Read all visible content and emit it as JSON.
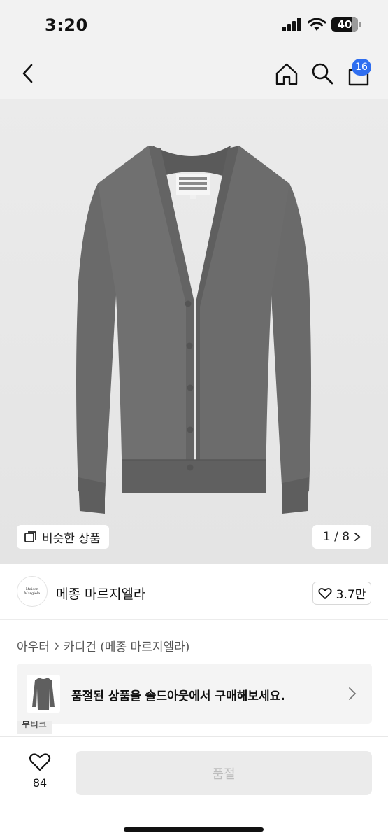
{
  "status_bar": {
    "time": "3:20",
    "battery": "40"
  },
  "nav": {
    "cart_count": "16"
  },
  "gallery": {
    "similar_label": "비슷한 상품",
    "pager": "1 / 8"
  },
  "brand": {
    "name": "메종 마르지엘라",
    "likes": "3.7만",
    "logo_text": "Maison Margiela"
  },
  "breadcrumb": {
    "category": "아우터",
    "subcategory": "카디건 (메종 마르지엘라)"
  },
  "soldout_banner": {
    "text": "품절된 상품을 솔드아웃에서 구매해보세요."
  },
  "boutique_tag": "부티크",
  "bottom_bar": {
    "wish_count": "84",
    "cta_label": "품절"
  },
  "colors": {
    "accent": "#2f6ef0",
    "garment": "#6b6b6b",
    "page_bg": "#ffffff"
  },
  "icons": [
    "back-arrow-icon",
    "home-icon",
    "search-icon",
    "shopping-bag-icon",
    "copy-icon",
    "chevron-right-icon",
    "heart-icon"
  ]
}
